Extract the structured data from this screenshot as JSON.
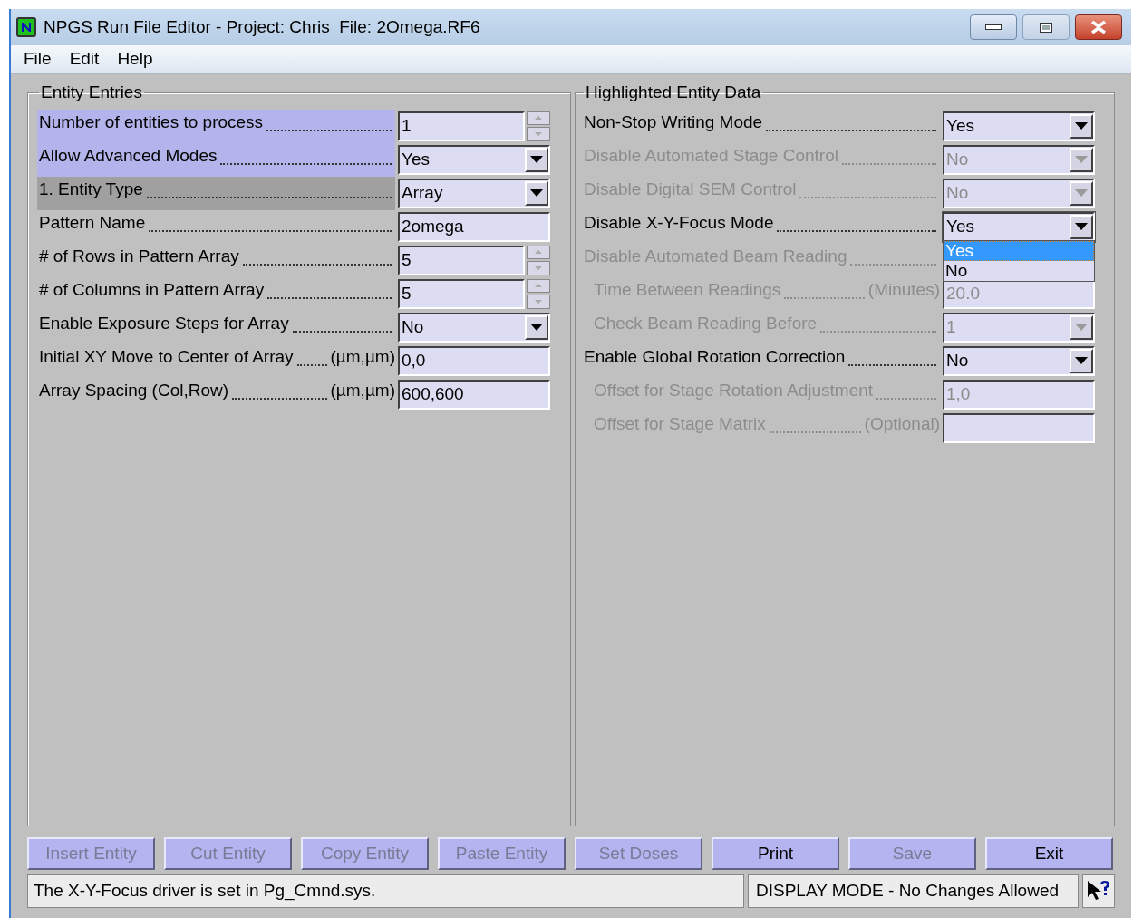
{
  "window": {
    "title": "NPGS Run File Editor - Project: Chris  File: 2Omega.RF6"
  },
  "menu": [
    "File",
    "Edit",
    "Help"
  ],
  "entity_entries": {
    "title": "Entity Entries",
    "rows": [
      {
        "label": "Number of entities to process",
        "kind": "spin",
        "value": "1",
        "selected": true,
        "current": false
      },
      {
        "label": "Allow Advanced Modes",
        "kind": "dropdown",
        "value": "Yes",
        "selected": true,
        "current": false
      },
      {
        "label": "1. Entity Type",
        "kind": "dropdown",
        "value": "Array",
        "selected": false,
        "current": true
      },
      {
        "label": "Pattern Name",
        "kind": "text",
        "value": "2omega",
        "selected": false,
        "current": false
      },
      {
        "label": "# of Rows in Pattern Array",
        "kind": "spin",
        "value": "5",
        "selected": false,
        "current": false
      },
      {
        "label": "# of Columns in Pattern Array",
        "kind": "spin",
        "value": "5",
        "selected": false,
        "current": false
      },
      {
        "label": "Enable Exposure Steps for Array",
        "kind": "dropdown",
        "value": "No",
        "selected": false,
        "current": false
      },
      {
        "label": "Initial XY Move to Center of Array",
        "unit": "(µm,µm)",
        "kind": "text",
        "value": "0,0",
        "selected": false,
        "current": false
      },
      {
        "label": "Array Spacing (Col,Row)",
        "unit": "(µm,µm)",
        "kind": "text",
        "value": "600,600",
        "selected": false,
        "current": false
      }
    ]
  },
  "highlighted_entity_data": {
    "title": "Highlighted Entity Data",
    "rows": [
      {
        "label": "Non-Stop Writing Mode",
        "kind": "dropdown",
        "value": "Yes",
        "disabled": false
      },
      {
        "label": "Disable Automated Stage Control",
        "kind": "dropdown",
        "value": "No",
        "disabled": true
      },
      {
        "label": "Disable Digital SEM Control",
        "kind": "dropdown",
        "value": "No",
        "disabled": true
      },
      {
        "label": "Disable X-Y-Focus Mode",
        "kind": "dropdown",
        "value": "Yes",
        "disabled": false,
        "expanded": true,
        "options": [
          {
            "label": "Yes",
            "selected": true
          },
          {
            "label": "No",
            "selected": false
          }
        ]
      },
      {
        "label": "Disable Automated Beam Reading",
        "kind": "hidden",
        "disabled": true,
        "children": [
          {
            "label": "Time Between Readings",
            "unit": "(Minutes)",
            "kind": "text",
            "value": "20.0",
            "disabled": true
          },
          {
            "label": "Check Beam Reading Before",
            "kind": "dropdown",
            "value": "1",
            "disabled": true
          }
        ]
      },
      {
        "label": "Enable Global Rotation Correction",
        "kind": "dropdown",
        "value": "No",
        "disabled": false,
        "children": [
          {
            "label": "Offset for Stage Rotation Adjustment",
            "kind": "text",
            "value": "1,0",
            "disabled": true
          },
          {
            "label": "Offset for Stage Matrix",
            "unit": "(Optional)",
            "kind": "text",
            "disabled": true
          }
        ]
      }
    ]
  },
  "buttons": [
    {
      "label": "Insert Entity",
      "disabled": true
    },
    {
      "label": "Cut Entity",
      "disabled": true
    },
    {
      "label": "Copy Entity",
      "disabled": true
    },
    {
      "label": "Paste Entity",
      "disabled": true
    },
    {
      "label": "Set Doses",
      "disabled": true
    },
    {
      "label": "Print",
      "disabled": false
    },
    {
      "label": "Save",
      "disabled": true
    },
    {
      "label": "Exit",
      "disabled": false
    }
  ],
  "status_bar": {
    "message": "The X-Y-Focus driver is set in Pg_Cmnd.sys.",
    "mode": "DISPLAY MODE - No Changes Allowed"
  }
}
